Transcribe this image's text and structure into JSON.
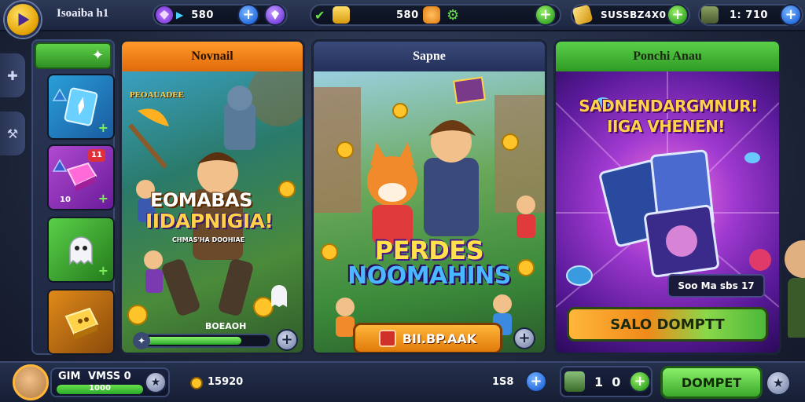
{
  "topbar": {
    "player_name": "Isoaiba h1",
    "gems_value": "580",
    "cash_value": "580",
    "gold_value": "SUSSBZ4X0",
    "level_value": "1: 710"
  },
  "left_column": {
    "slot_2_badge": "11",
    "slot_2_label": "10"
  },
  "panels": [
    {
      "header": "Novnail",
      "tag": "PEOAUADEE",
      "title_line1": "EOMABAS",
      "title_line2": "IIDAPNIGIA!",
      "subtitle": "CHMAS'HA DOOHIAE",
      "bar_label": "BOEAOH"
    },
    {
      "header": "Sapne",
      "title_line1": "PERDES",
      "title_line2": "NOOMAHINS",
      "button_label": "BII.BP.AAK"
    },
    {
      "header": "Ponchi Anau",
      "title_line1": "SADNENDARGMNUR!",
      "title_line2": "IIGA VHENEN!",
      "info_label": "Soo Ma sbs 17",
      "button_label": "SALO DOMPTT"
    }
  ],
  "bottombar": {
    "xp_label": "GIM",
    "xp_name": "VMSS 0",
    "xp_value": "1000",
    "coin_value": "15920",
    "mid_value": "1S8",
    "friends_value": "1  0",
    "main_button": "DOMPET"
  },
  "colors": {
    "panel1_header": "#f07a10",
    "panel2_header": "#2c3a6a",
    "panel3_header": "#3ca832",
    "accent_orange": "#ff9a1a",
    "accent_green": "#4cc83a"
  }
}
